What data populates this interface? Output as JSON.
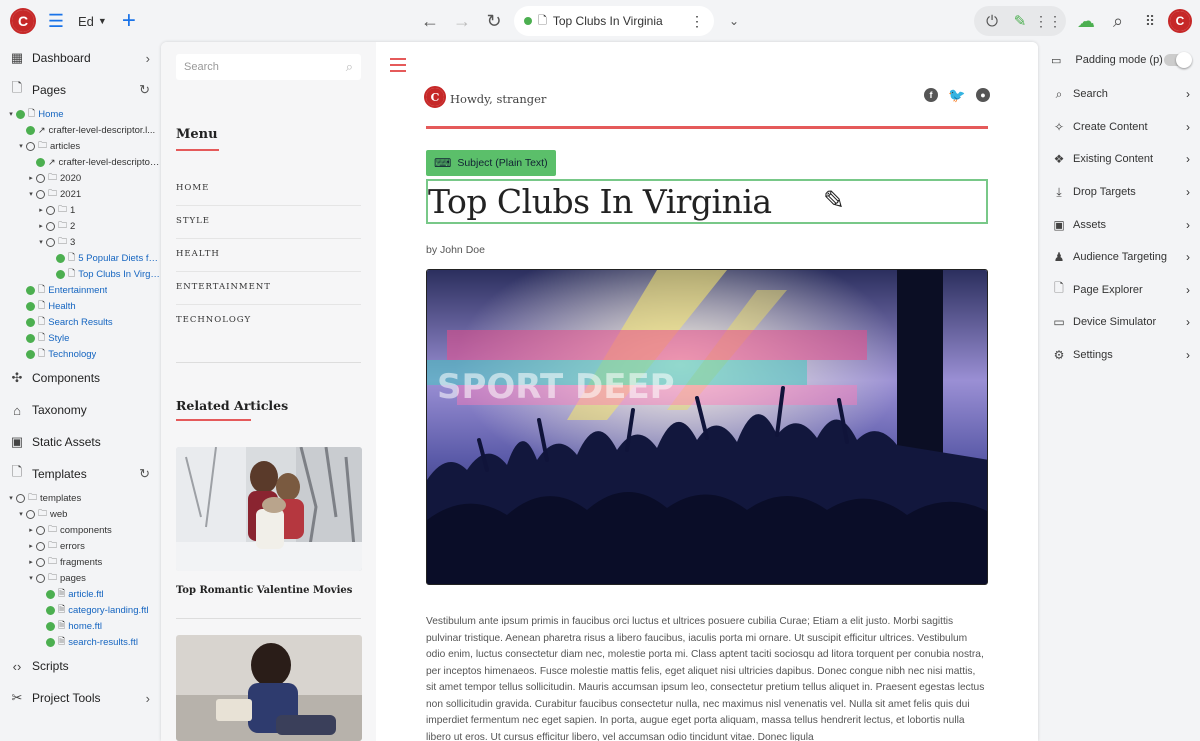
{
  "topbar": {
    "site_label": "Ed",
    "address_title": "Top Clubs In Virginia"
  },
  "sidebar": {
    "dashboard": "Dashboard",
    "pages": "Pages",
    "components": "Components",
    "taxonomy": "Taxonomy",
    "static_assets": "Static Assets",
    "templates": "Templates",
    "scripts": "Scripts",
    "project_tools": "Project Tools",
    "pages_tree": [
      {
        "indent": 0,
        "tw": "▾",
        "st": "g",
        "fi": "🗋",
        "label": "Home",
        "link": true
      },
      {
        "indent": 1,
        "tw": "",
        "st": "g",
        "fi": "↗",
        "label": "crafter-level-descriptor.l...",
        "link": false
      },
      {
        "indent": 1,
        "tw": "▾",
        "st": "o",
        "fi": "🗀",
        "label": "articles",
        "link": false
      },
      {
        "indent": 2,
        "tw": "",
        "st": "g",
        "fi": "↗",
        "label": "crafter-level-descriptor...",
        "link": false
      },
      {
        "indent": 2,
        "tw": "▸",
        "st": "o",
        "fi": "🗀",
        "label": "2020",
        "link": false
      },
      {
        "indent": 2,
        "tw": "▾",
        "st": "o",
        "fi": "🗀",
        "label": "2021",
        "link": false
      },
      {
        "indent": 3,
        "tw": "▸",
        "st": "o",
        "fi": "🗀",
        "label": "1",
        "link": false
      },
      {
        "indent": 3,
        "tw": "▸",
        "st": "o",
        "fi": "🗀",
        "label": "2",
        "link": false
      },
      {
        "indent": 3,
        "tw": "▾",
        "st": "o",
        "fi": "🗀",
        "label": "3",
        "link": false
      },
      {
        "indent": 4,
        "tw": "",
        "st": "g",
        "fi": "🗋",
        "label": "5 Popular Diets for...",
        "link": true
      },
      {
        "indent": 4,
        "tw": "",
        "st": "g",
        "fi": "🗋",
        "label": "Top Clubs In Virginia",
        "link": true
      },
      {
        "indent": 1,
        "tw": "",
        "st": "g",
        "fi": "🗋",
        "label": "Entertainment",
        "link": true
      },
      {
        "indent": 1,
        "tw": "",
        "st": "g",
        "fi": "🗋",
        "label": "Health",
        "link": true
      },
      {
        "indent": 1,
        "tw": "",
        "st": "g",
        "fi": "🗋",
        "label": "Search Results",
        "link": true
      },
      {
        "indent": 1,
        "tw": "",
        "st": "g",
        "fi": "🗋",
        "label": "Style",
        "link": true
      },
      {
        "indent": 1,
        "tw": "",
        "st": "g",
        "fi": "🗋",
        "label": "Technology",
        "link": true
      }
    ],
    "templates_tree": [
      {
        "indent": 0,
        "tw": "▾",
        "st": "o",
        "fi": "🗀",
        "label": "templates",
        "link": false
      },
      {
        "indent": 1,
        "tw": "▾",
        "st": "o",
        "fi": "🗀",
        "label": "web",
        "link": false
      },
      {
        "indent": 2,
        "tw": "▸",
        "st": "o",
        "fi": "🗀",
        "label": "components",
        "link": false
      },
      {
        "indent": 2,
        "tw": "▸",
        "st": "o",
        "fi": "🗀",
        "label": "errors",
        "link": false
      },
      {
        "indent": 2,
        "tw": "▸",
        "st": "o",
        "fi": "🗀",
        "label": "fragments",
        "link": false
      },
      {
        "indent": 2,
        "tw": "▾",
        "st": "o",
        "fi": "🗀",
        "label": "pages",
        "link": false
      },
      {
        "indent": 3,
        "tw": "",
        "st": "g",
        "fi": "🗎",
        "label": "article.ftl",
        "link": true
      },
      {
        "indent": 3,
        "tw": "",
        "st": "g",
        "fi": "🗎",
        "label": "category-landing.ftl",
        "link": true
      },
      {
        "indent": 3,
        "tw": "",
        "st": "g",
        "fi": "🗎",
        "label": "home.ftl",
        "link": true
      },
      {
        "indent": 3,
        "tw": "",
        "st": "g",
        "fi": "🗎",
        "label": "search-results.ftl",
        "link": true
      }
    ]
  },
  "preview": {
    "search_placeholder": "Search",
    "menu_title": "Menu",
    "menu_items": [
      "HOME",
      "STYLE",
      "HEALTH",
      "ENTERTAINMENT",
      "TECHNOLOGY"
    ],
    "related_title": "Related Articles",
    "related_1": "Top Romantic Valentine Movies",
    "greeting": "Howdy, stranger",
    "subject_tag": "Subject (Plain Text)",
    "article_title": "Top Clubs In Virginia",
    "byline": "by John Doe",
    "body": "Vestibulum ante ipsum primis in faucibus orci luctus et ultrices posuere cubilia Curae; Etiam a elit justo. Morbi sagittis pulvinar tristique. Aenean pharetra risus a libero faucibus, iaculis porta mi ornare. Ut suscipit efficitur ultrices. Vestibulum odio enim, luctus consectetur diam nec, molestie porta mi. Class aptent taciti sociosqu ad litora torquent per conubia nostra, per inceptos himenaeos. Fusce molestie mattis felis, eget aliquet nisi ultricies dapibus. Donec congue nibh nec nisi mattis, sit amet tempor tellus sollicitudin. Mauris accumsan ipsum leo, consectetur pretium tellus aliquet in. Praesent egestas lectus non sollicitudin gravida. Curabitur faucibus consectetur nulla, nec maximus nisl venenatis vel. Nulla sit amet felis quis dui imperdiet fermentum nec eget sapien. In porta, augue eget porta aliquam, massa tellus hendrerit lectus, et lobortis nulla libero ut eros. Ut cursus efficitur libero, vel accumsan odio tincidunt vitae. Donec ligula"
  },
  "right_panel": {
    "padding_mode": "Padding mode (p)",
    "items": [
      "Search",
      "Create Content",
      "Existing Content",
      "Drop Targets",
      "Assets",
      "Audience Targeting",
      "Page Explorer",
      "Device Simulator",
      "Settings"
    ]
  }
}
